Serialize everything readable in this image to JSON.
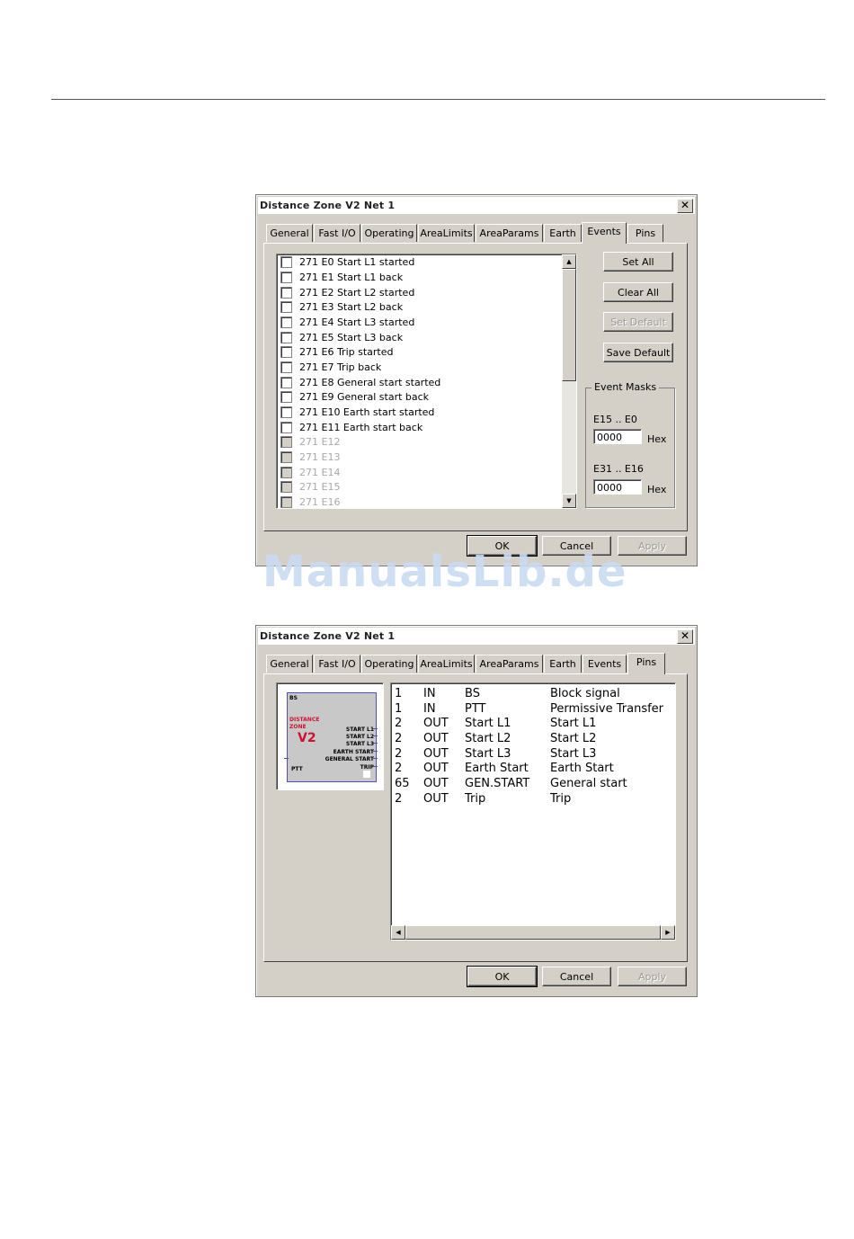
{
  "dialog_events": {
    "title": "Distance Zone V2 Net 1",
    "close": "✕",
    "tabs": [
      "General",
      "Fast I/O",
      "Operating",
      "AreaLimits",
      "AreaParams",
      "Earth",
      "Events",
      "Pins"
    ],
    "active_tab": "Events",
    "events": [
      {
        "label": "271  E0  Start  L1  started",
        "enabled": true,
        "checked": false
      },
      {
        "label": "271  E1  Start  L1  back",
        "enabled": true,
        "checked": false
      },
      {
        "label": "271  E2  Start  L2  started",
        "enabled": true,
        "checked": false
      },
      {
        "label": "271  E3  Start  L2 back",
        "enabled": true,
        "checked": false
      },
      {
        "label": "271  E4  Start  L3  started",
        "enabled": true,
        "checked": false
      },
      {
        "label": "271  E5  Start  L3 back",
        "enabled": true,
        "checked": false
      },
      {
        "label": "271  E6  Trip  started",
        "enabled": true,
        "checked": false
      },
      {
        "label": "271  E7  Trip back",
        "enabled": true,
        "checked": false
      },
      {
        "label": "271  E8  General start started",
        "enabled": true,
        "checked": false
      },
      {
        "label": "271  E9  General start back",
        "enabled": true,
        "checked": false
      },
      {
        "label": "271  E10  Earth start started",
        "enabled": true,
        "checked": false
      },
      {
        "label": "271  E11  Earth start back",
        "enabled": true,
        "checked": false
      },
      {
        "label": "271  E12",
        "enabled": false,
        "checked": false
      },
      {
        "label": "271  E13",
        "enabled": false,
        "checked": false
      },
      {
        "label": "271  E14",
        "enabled": false,
        "checked": false
      },
      {
        "label": "271  E15",
        "enabled": false,
        "checked": false
      },
      {
        "label": "271  E16",
        "enabled": false,
        "checked": false
      }
    ],
    "buttons": {
      "set_all": "Set All",
      "clear_all": "Clear All",
      "set_default": "Set Default",
      "save_default": "Save Default"
    },
    "event_masks": {
      "label": "Event Masks",
      "range1_label": "E15 .. E0",
      "range1_value": "0000",
      "range2_label": "E31 .. E16",
      "range2_value": "0000",
      "unit": "Hex"
    },
    "footer": {
      "ok": "OK",
      "cancel": "Cancel",
      "apply": "Apply"
    }
  },
  "dialog_pins": {
    "title": "Distance Zone V2 Net 1",
    "close": "✕",
    "tabs": [
      "General",
      "Fast I/O",
      "Operating",
      "AreaLimits",
      "AreaParams",
      "Earth",
      "Events",
      "Pins"
    ],
    "active_tab": "Pins",
    "symbol": {
      "top_left": "BS",
      "name_line1": "DISTANCE",
      "name_line2": "ZONE",
      "version": "V2",
      "left_pin": "PTT",
      "outputs": [
        "START L1",
        "START L2",
        "START L3",
        "EARTH START",
        "GENERAL START",
        "TRIP"
      ]
    },
    "pins": [
      {
        "num": "1",
        "dir": "IN",
        "name": "BS",
        "desc": "Block signal"
      },
      {
        "num": "1",
        "dir": "IN",
        "name": "PTT",
        "desc": "Permissive Transfer"
      },
      {
        "num": "2",
        "dir": "OUT",
        "name": "Start L1",
        "desc": "Start L1"
      },
      {
        "num": "2",
        "dir": "OUT",
        "name": "Start L2",
        "desc": "Start L2"
      },
      {
        "num": "2",
        "dir": "OUT",
        "name": "Start L3",
        "desc": "Start L3"
      },
      {
        "num": "2",
        "dir": "OUT",
        "name": "Earth Start",
        "desc": "Earth Start"
      },
      {
        "num": "65",
        "dir": "OUT",
        "name": "GEN.START",
        "desc": "General start"
      },
      {
        "num": "2",
        "dir": "OUT",
        "name": "Trip",
        "desc": "Trip"
      }
    ],
    "footer": {
      "ok": "OK",
      "cancel": "Cancel",
      "apply": "Apply"
    }
  },
  "watermark": "ManualsLib.de"
}
